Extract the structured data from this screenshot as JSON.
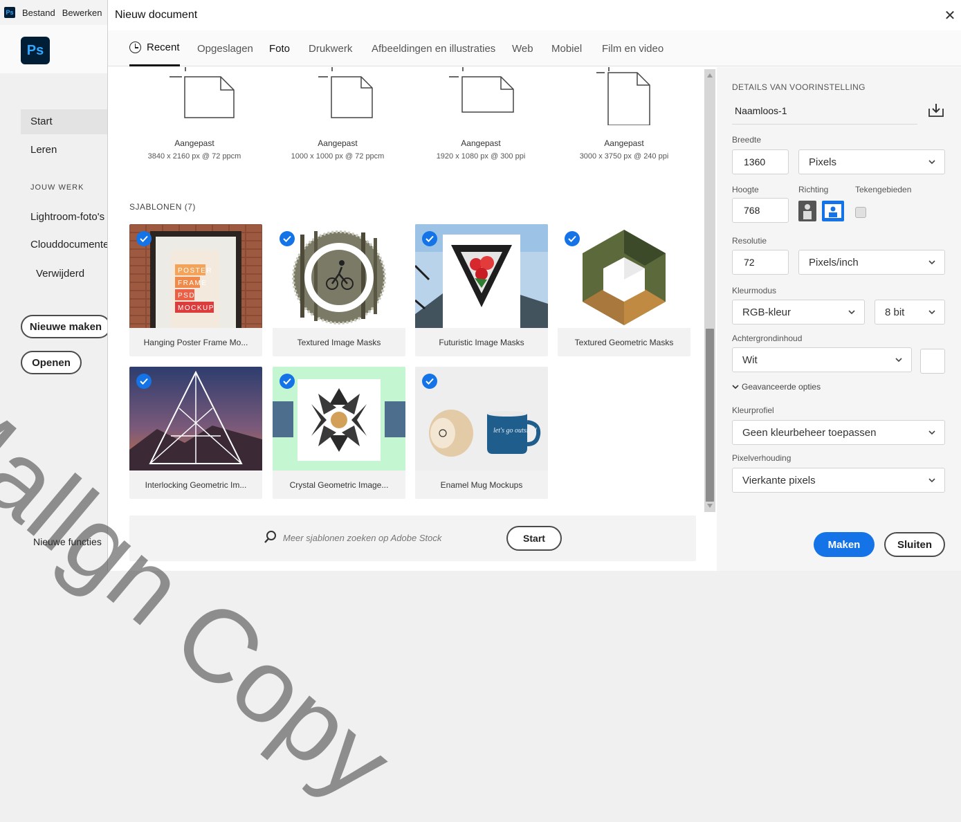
{
  "app": {
    "menu": [
      "Bestand",
      "Bewerken"
    ],
    "logo": "Ps",
    "sidebar": {
      "items": [
        {
          "label": "Start",
          "active": true
        },
        {
          "label": "Leren",
          "active": false
        }
      ],
      "section_heading": "JOUW WERK",
      "work_items": [
        "Lightroom-foto's",
        "Clouddocumenten",
        "Verwijderd"
      ],
      "new_button": "Nieuwe maken",
      "open_button": "Openen",
      "footer_item": "Nieuwe functies"
    }
  },
  "dialog": {
    "title": "Nieuw document",
    "tabs": [
      {
        "label": "Recent",
        "active": true
      },
      {
        "label": "Opgeslagen"
      },
      {
        "label": "Foto"
      },
      {
        "label": "Drukwerk"
      },
      {
        "label": "Afbeeldingen en illustraties"
      },
      {
        "label": "Web"
      },
      {
        "label": "Mobiel"
      },
      {
        "label": "Film en video"
      }
    ],
    "recent_presets": [
      {
        "name": "Aangepast",
        "size": "3840 x 2160 px @ 72 ppcm",
        "orientation": "landscape"
      },
      {
        "name": "Aangepast",
        "size": "1000 x 1000 px @ 72 ppcm",
        "orientation": "square"
      },
      {
        "name": "Aangepast",
        "size": "1920 x 1080 px @ 300 ppi",
        "orientation": "landscape"
      },
      {
        "name": "Aangepast",
        "size": "3000 x 3750 px @ 240 ppi",
        "orientation": "portrait"
      }
    ],
    "templates_heading": "SJABLONEN  (7)",
    "templates": [
      {
        "name": "Hanging Poster Frame Mo...",
        "thumb": "poster-frame"
      },
      {
        "name": "Textured Image Masks",
        "thumb": "textured-circle"
      },
      {
        "name": "Futuristic Image Masks",
        "thumb": "futuristic-triangle"
      },
      {
        "name": "Textured Geometric Masks",
        "thumb": "geometric-hexagon"
      },
      {
        "name": "Interlocking Geometric Im...",
        "thumb": "interlocking-triangle"
      },
      {
        "name": "Crystal Geometric Image...",
        "thumb": "crystal-snowflake"
      },
      {
        "name": "Enamel Mug Mockups",
        "thumb": "enamel-mugs"
      }
    ],
    "poster_words": [
      "POSTER",
      "FRAME",
      "PSD",
      "MOCKUP"
    ],
    "mug_text": "let's go outside!",
    "search": {
      "placeholder": "Meer sjablonen zoeken op Adobe Stock",
      "button": "Start"
    },
    "details": {
      "heading": "DETAILS VAN VOORINSTELLING",
      "name": "Naamloos-1",
      "width_label": "Breedte",
      "width_value": "1360",
      "width_unit": "Pixels",
      "height_label": "Hoogte",
      "height_value": "768",
      "orientation_label": "Richting",
      "artboards_label": "Tekengebieden",
      "resolution_label": "Resolutie",
      "resolution_value": "72",
      "resolution_unit": "Pixels/inch",
      "color_mode_label": "Kleurmodus",
      "color_mode": "RGB-kleur",
      "bit_depth": "8 bit",
      "background_label": "Achtergrondinhoud",
      "background": "Wit",
      "advanced_label": "Geavanceerde opties",
      "color_profile_label": "Kleurprofiel",
      "color_profile": "Geen kleurbeheer toepassen",
      "pixel_aspect_label": "Pixelverhouding",
      "pixel_aspect": "Vierkante pixels",
      "make_button": "Maken",
      "close_button": "Sluiten"
    }
  },
  "watermark": "Mallgn Copy",
  "colors": {
    "accent": "#1473e6",
    "ps_dark": "#001e36",
    "ps_blue": "#31a8ff"
  }
}
